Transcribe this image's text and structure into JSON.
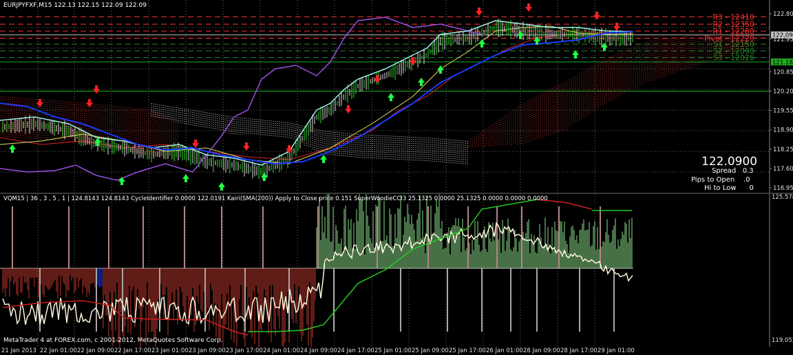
{
  "chart_header": {
    "symbol_line": "EURJPYFXF,M15",
    "ohlc": "122.13 122.15 122.09 122.09"
  },
  "pivots": [
    {
      "label": "R3 - 12410",
      "value": 122.7,
      "color": "#ff3333"
    },
    {
      "label": "R2 - 12350",
      "value": 122.45,
      "color": "#ff3333"
    },
    {
      "label": "R1 - 12280",
      "value": 122.22,
      "color": "#ff3333"
    },
    {
      "label": "Pivot - 12220",
      "value": 121.98,
      "color": "#ff3333"
    },
    {
      "label": "S1 - 12150",
      "value": 121.78,
      "color": "#2a8a2a"
    },
    {
      "label": "S2 - 12090",
      "value": 121.55,
      "color": "#2a8a2a"
    },
    {
      "label": "S3 - 12026",
      "value": 121.33,
      "color": "#2a8a2a"
    }
  ],
  "info_panel": {
    "price": "122.0900",
    "spread_label": "Spread",
    "spread_value": "0.3",
    "pips_label": "Pips to Open",
    "pips_value": ".0",
    "hilo_label": "Hi to Low",
    "hilo_value": "0"
  },
  "indicator_header": {
    "text": "VQM15 | 36 , 3 , 5 , 1 |  124.8143 124.8143  CycleIdentifier 0.0000 122.0191  Kairi(SMA(200)) Apply to Close price 0.151  SuperWoodieCCI3 25.1325 0.0000 25.1325 0.0000 0.0000 0.0000"
  },
  "copyright": "MetaTrader 4 at FOREX.com, c 2001-2012, MetaQuotes Software Corp.",
  "price_axis": {
    "labels": [
      "122.80",
      "122.09",
      "121.95",
      "121.18",
      "120.85",
      "120.20",
      "119.55",
      "118.90",
      "118.25",
      "117.60",
      "116.95"
    ],
    "current_price": "122.09",
    "level_price": "121.18"
  },
  "sub_axis": {
    "top": "125.578",
    "bottom": "119.052"
  },
  "time_axis": {
    "labels": [
      "21 Jan 2013",
      "22 Jan 01:00",
      "22 Jan 09:00",
      "22 Jan 17:00",
      "23 Jan 01:00",
      "23 Jan 09:00",
      "23 Jan 17:00",
      "24 Jan 01:00",
      "24 Jan 09:00",
      "24 Jan 17:00",
      "25 Jan 01:00",
      "25 Jan 09:00",
      "25 Jan 17:00",
      "26 Jan 01:00",
      "28 Jan 09:00",
      "28 Jan 17:00",
      "29 Jan 01:00"
    ]
  },
  "colors": {
    "background": "#000000",
    "grid": "#6e6e6e",
    "price_line": "#c0c0c0",
    "purple_line": "#9b4fe0",
    "blue_line": "#1a3cff",
    "cyan_line": "#9ff0e8",
    "green_bars": "#33dd33",
    "red_arrow": "#ff2020",
    "green_arrow": "#22ff44",
    "cloud_red": "#b83030",
    "cloud_white": "#dddddd",
    "info_price": "#22ff22",
    "info_cyan": "#22cce6",
    "info_yellow": "#f7f26a",
    "info_red": "#ff2020",
    "info_blue": "#2244ff",
    "osc_red": "#c0392b",
    "osc_green": "#8ee08e",
    "osc_white": "#fff6dc",
    "osc_green_line": "#22cc22"
  }
}
